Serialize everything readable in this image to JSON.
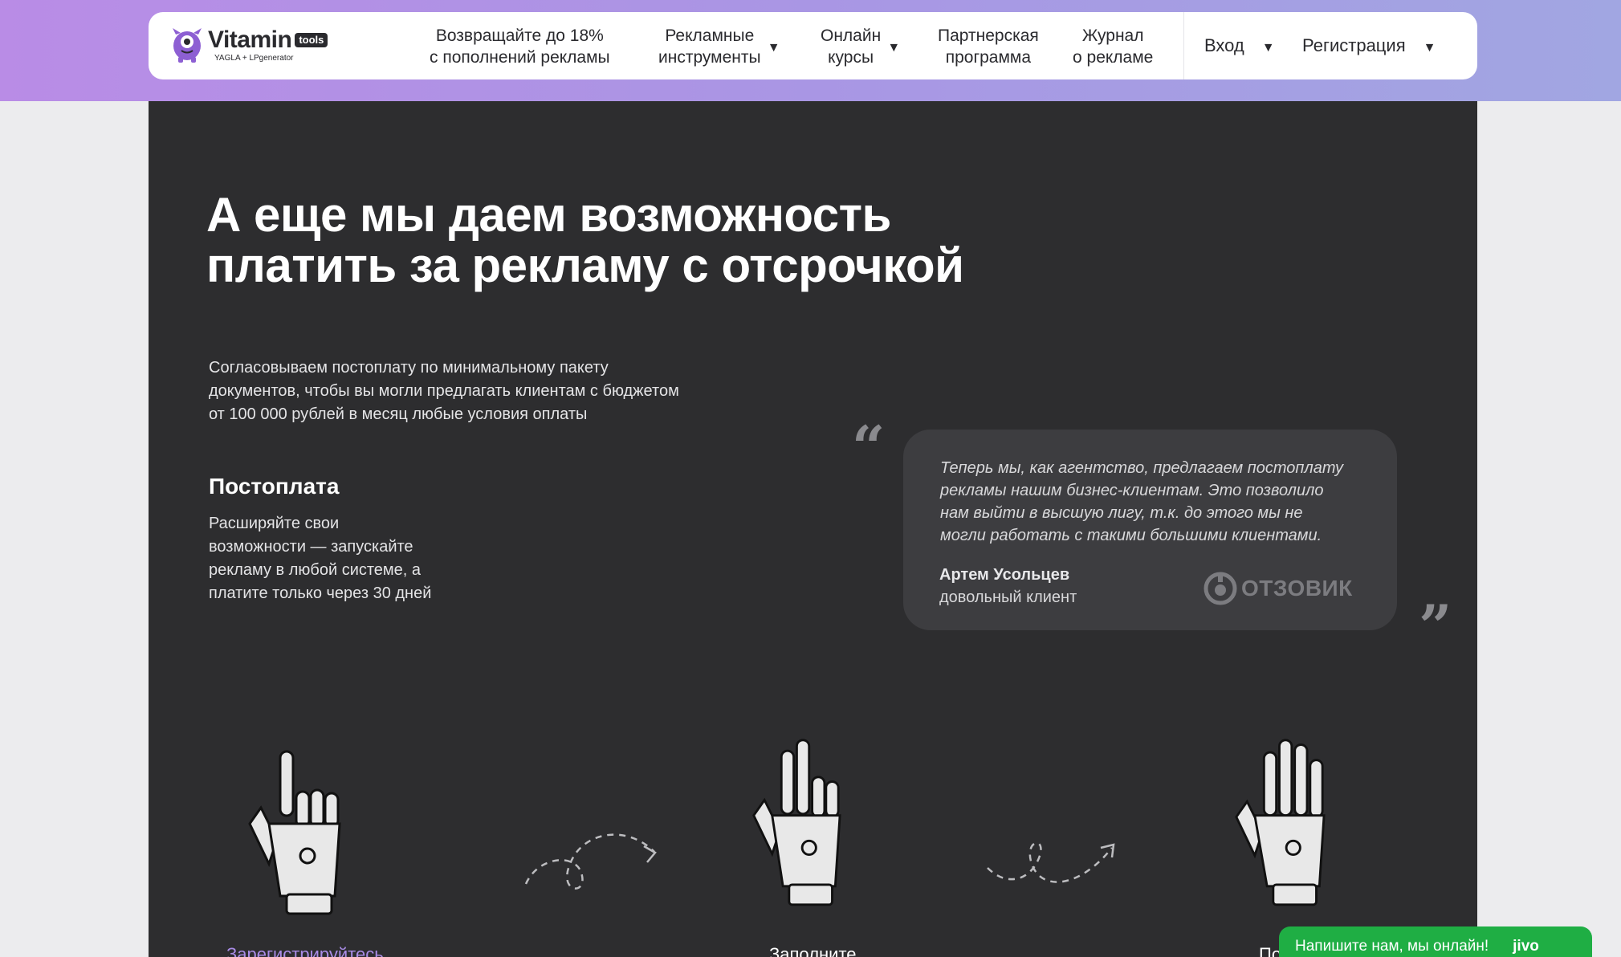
{
  "brand": {
    "name": "Vitamin",
    "tag": "tools",
    "sub": "YAGLA + LPgenerator",
    "accent": "#8d5fd3"
  },
  "nav": {
    "cashback": [
      "Возвращайте до 18%",
      "с пополнений рекламы"
    ],
    "tools": [
      "Рекламные",
      "инструменты"
    ],
    "courses": [
      "Онлайн",
      "курсы"
    ],
    "partner": [
      "Партнерская",
      "программа"
    ],
    "journal": [
      "Журнал",
      "о рекламе"
    ],
    "login": "Вход",
    "register": "Регистрация",
    "caret": "▼"
  },
  "hero": {
    "title_lines": [
      "А еще мы даем возможность",
      "платить за рекламу с отсрочкой"
    ],
    "intro_lines": [
      "Согласовываем постоплату по минимальному пакету",
      "документов, чтобы вы могли предлагать клиентам с бюджетом",
      "от 100 000 рублей в месяц любые условия оплаты"
    ]
  },
  "postpay": {
    "title": "Постоплата",
    "lines": [
      "Расширяйте свои",
      "возможности — запускайте",
      "рекламу в любой системе, а",
      "платите только через 30 дней"
    ]
  },
  "testimonial": {
    "open_mark": "“",
    "close_mark": "”",
    "lines": [
      "Теперь мы, как агентство, предлагаем постоплату",
      "рекламы нашим бизнес-клиентам. Это позволило",
      "нам выйти в высшую лигу, т.к. до этого мы не",
      "могли работать с такими большими клиентами."
    ],
    "author": "Артем Усольцев",
    "role": "довольный клиент",
    "source": "ОТЗОВИК"
  },
  "steps": [
    {
      "label": "Зарегистрируйтесь",
      "color": "#a98ce6"
    },
    {
      "label": "Заполните",
      "color": "#ffffff"
    },
    {
      "label": "По",
      "color": "#ffffff"
    }
  ],
  "chat": {
    "text": "Напишите нам, мы онлайн!",
    "brand": "jivo"
  }
}
